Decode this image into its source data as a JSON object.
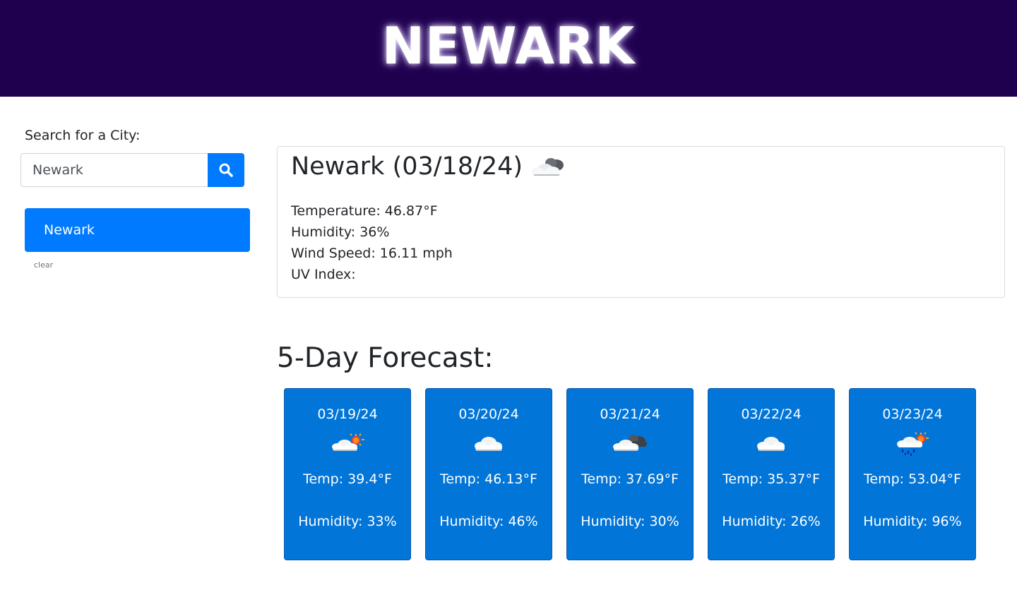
{
  "header": {
    "city_title": "NEWARK"
  },
  "search": {
    "label": "Search for a City:",
    "input_value": "Newark",
    "button_icon": "search-icon"
  },
  "history": {
    "items": [
      {
        "label": "Newark"
      }
    ],
    "clear_label": "clear"
  },
  "current": {
    "title": "Newark (03/18/24)",
    "icon": "cloud-icon",
    "temperature": "Temperature: 46.87°F",
    "humidity": "Humidity: 36%",
    "wind": "Wind Speed: 16.11 mph",
    "uv": "UV Index:"
  },
  "forecast": {
    "heading": "5-Day Forecast:",
    "days": [
      {
        "date": "03/19/24",
        "icon": "partly-sunny-icon",
        "temp": "Temp: 39.4°F",
        "humidity": "Humidity: 33%"
      },
      {
        "date": "03/20/24",
        "icon": "cloud-icon",
        "temp": "Temp: 46.13°F",
        "humidity": "Humidity: 46%"
      },
      {
        "date": "03/21/24",
        "icon": "broken-clouds-icon",
        "temp": "Temp: 37.69°F",
        "humidity": "Humidity: 30%"
      },
      {
        "date": "03/22/24",
        "icon": "cloud-icon",
        "temp": "Temp: 35.37°F",
        "humidity": "Humidity: 26%"
      },
      {
        "date": "03/23/24",
        "icon": "rain-sun-icon",
        "temp": "Temp: 53.04°F",
        "humidity": "Humidity: 96%"
      }
    ]
  },
  "colors": {
    "header_bg": "#1f004f",
    "accent_blue": "#007bff",
    "card_blue": "#0275d8"
  }
}
